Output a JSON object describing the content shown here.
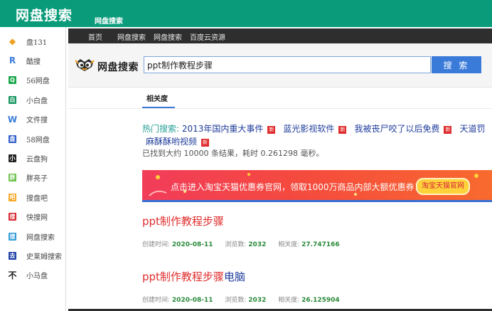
{
  "header": {
    "brand": "网盘搜索",
    "tab": "网盘搜索"
  },
  "sidebar": {
    "items": [
      {
        "label": "盘131",
        "icon": "diamond-icon",
        "glyph": "◆",
        "color": "#f0a020"
      },
      {
        "label": "酷搜",
        "icon": "r-logo-icon",
        "glyph": "R",
        "color": "#3a7bd9"
      },
      {
        "label": "56网盘",
        "icon": "q-logo-icon",
        "glyph": "Q",
        "color": "#1aa84a"
      },
      {
        "label": "小白盘",
        "icon": "square-logo-icon",
        "glyph": "白",
        "color": "#15955e"
      },
      {
        "label": "文件搜",
        "icon": "w-logo-icon",
        "glyph": "W",
        "color": "#3a7bd9"
      },
      {
        "label": "58网盘",
        "icon": "disk-logo-icon",
        "glyph": "盘",
        "color": "#2a5bc9"
      },
      {
        "label": "云盘狗",
        "icon": "dog-logo-icon",
        "glyph": "小",
        "color": "#222222"
      },
      {
        "label": "胖亮子",
        "icon": "fat-logo-icon",
        "glyph": "胖",
        "color": "#6ac14a"
      },
      {
        "label": "搜盘吧",
        "icon": "search-logo-icon",
        "glyph": "吧",
        "color": "#f5a623"
      },
      {
        "label": "快搜网",
        "icon": "fast-logo-icon",
        "glyph": "搜",
        "color": "#d9232d"
      },
      {
        "label": "网盘搜索",
        "icon": "pan-logo-icon",
        "glyph": "搜",
        "color": "#2d9bd8"
      },
      {
        "label": "史莱姆搜索",
        "icon": "slime-logo-icon",
        "glyph": "去",
        "color": "#1e40a8"
      },
      {
        "label": "小马盘",
        "icon": "horse-logo-icon",
        "glyph": "不",
        "color": "#ffffff"
      }
    ]
  },
  "nav": {
    "links": [
      "首页",
      "网盘搜索",
      "网盘搜索",
      "百度云资源"
    ]
  },
  "search": {
    "logo_text": "网盘搜索",
    "query": "ppt制作教程步骤",
    "button": "搜 索"
  },
  "sort": {
    "tab": "相关度"
  },
  "hot": {
    "label": "热门搜索:",
    "badge": "新",
    "items": [
      "2013年国内重大事件",
      "蓝光影视软件",
      "我被丧尸咬了以后免费",
      "天道罚",
      "麻酥酥哟视频"
    ]
  },
  "found_text": "已找到大约 10000 条结果，耗时 0.261298 毫秒。",
  "banner": {
    "text": "点击进入淘宝天猫优惠券官网，领取1000万商品内部大额优惠券！",
    "badge": "淘宝天猫官网"
  },
  "results": [
    {
      "title": "ppt制作教程步骤",
      "title_extra": "",
      "created_label": "创建时间:",
      "created": "2020-08-11",
      "views_label": "浏览数:",
      "views": "2032",
      "relevance_label": "相关度:",
      "relevance": "27.747166"
    },
    {
      "title": "ppt制作教程步骤",
      "title_extra": "电脑",
      "created_label": "创建时间:",
      "created": "2020-08-11",
      "views_label": "浏览数:",
      "views": "2032",
      "relevance_label": "相关度:",
      "relevance": "26.125904"
    }
  ]
}
